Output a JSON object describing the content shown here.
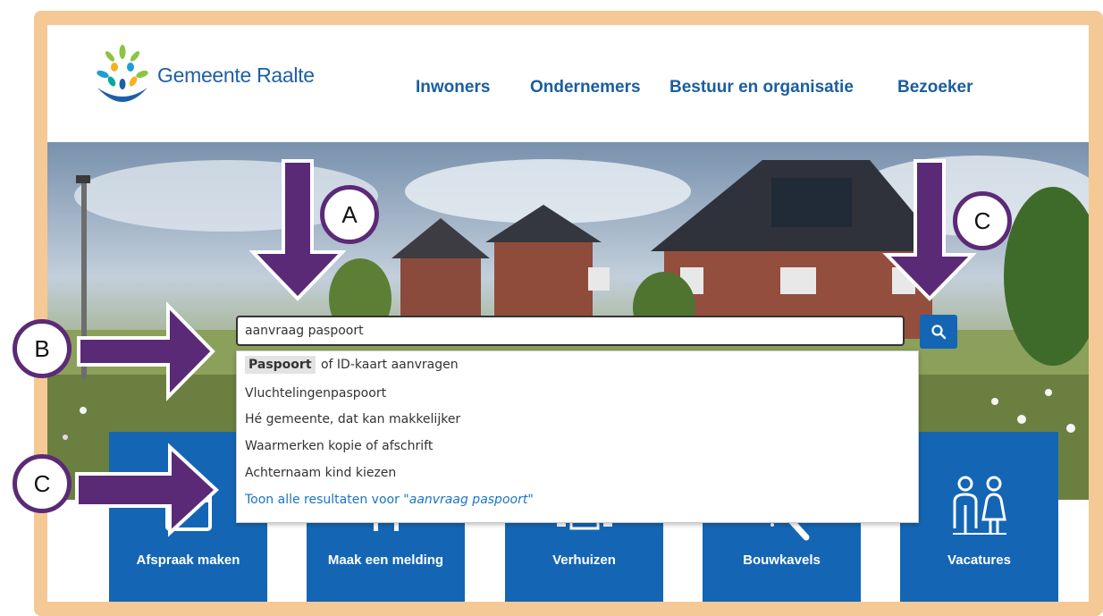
{
  "header": {
    "logo_text": "Gemeente Raalte",
    "nav": [
      "Inwoners",
      "Ondernemers",
      "Bestuur en organisatie",
      "Bezoeker"
    ]
  },
  "search": {
    "value": "aanvraag paspoort",
    "suggestions": [
      {
        "highlight": "Paspoort",
        "rest": " of ID-kaart aanvragen"
      },
      {
        "text": "Vluchtelingenpaspoort"
      },
      {
        "text": "Hé gemeente, dat kan makkelijker"
      },
      {
        "text": "Waarmerken kopie of afschrift"
      },
      {
        "text": "Achternaam kind kiezen"
      }
    ],
    "all_results_prefix": "Toon alle resultaten voor \"",
    "all_results_query": "aanvraag paspoort",
    "all_results_suffix": "\""
  },
  "tiles": [
    {
      "label": "Afspraak maken",
      "icon": "calendar-icon"
    },
    {
      "label": "Maak een melding",
      "icon": "tools-icon"
    },
    {
      "label": "Verhuizen",
      "icon": "moving-truck-icon"
    },
    {
      "label": "Bouwkavels",
      "icon": "shovel-icon"
    },
    {
      "label": "Vacatures",
      "icon": "people-icon"
    }
  ],
  "annotations": {
    "A": "A",
    "B": "B",
    "C_top": "C",
    "C_bottom": "C"
  },
  "colors": {
    "frame": "#f5c995",
    "brand_blue": "#1466b4",
    "nav_blue": "#1a5e9f",
    "arrow_purple": "#5b2a77",
    "link_blue": "#1b73c6"
  }
}
